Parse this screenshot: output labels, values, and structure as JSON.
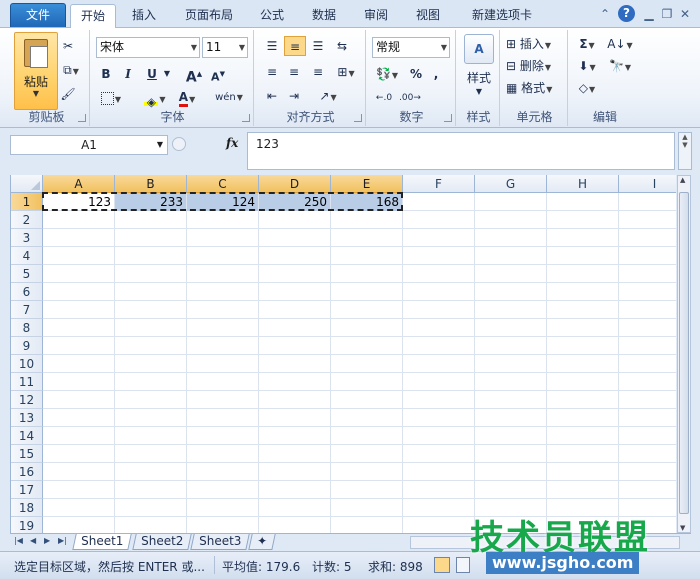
{
  "tabs": [
    "文件",
    "开始",
    "插入",
    "页面布局",
    "公式",
    "数据",
    "审阅",
    "视图",
    "新建选项卡"
  ],
  "ribbon": {
    "clipboard": {
      "label": "剪贴板",
      "paste": "粘贴"
    },
    "font": {
      "label": "字体",
      "name": "宋体",
      "size": "11",
      "grow": "A",
      "shrink": "A",
      "bold": "B",
      "italic": "I",
      "underline": "U",
      "wen": "wén"
    },
    "align": {
      "label": "对齐方式"
    },
    "number": {
      "label": "数字",
      "format": "常规",
      "percent": "%",
      "comma": ","
    },
    "styles": {
      "label": "样式",
      "btn": "样式"
    },
    "cells": {
      "label": "单元格",
      "insert": "插入",
      "delete": "删除",
      "format": "格式"
    },
    "editing": {
      "label": "编辑"
    }
  },
  "formula_bar": {
    "name_box": "A1",
    "fx": "fx",
    "content": "123"
  },
  "grid": {
    "columns": [
      "A",
      "B",
      "C",
      "D",
      "E",
      "F",
      "G",
      "H",
      "I"
    ],
    "rows": [
      "1",
      "2",
      "3",
      "4",
      "5",
      "6",
      "7",
      "8",
      "9",
      "10",
      "11",
      "12",
      "13",
      "14",
      "15",
      "16",
      "17",
      "18",
      "19"
    ],
    "row1_values": [
      "123",
      "233",
      "124",
      "250",
      "168"
    ]
  },
  "sheets": [
    "Sheet1",
    "Sheet2",
    "Sheet3"
  ],
  "status": {
    "message": "选定目标区域，然后按 ENTER 或...",
    "average": "平均值: 179.6",
    "count": "计数: 5",
    "sum": "求和: 898"
  },
  "watermark": {
    "text": "技术员联盟",
    "site": "www.jsgho.com"
  }
}
